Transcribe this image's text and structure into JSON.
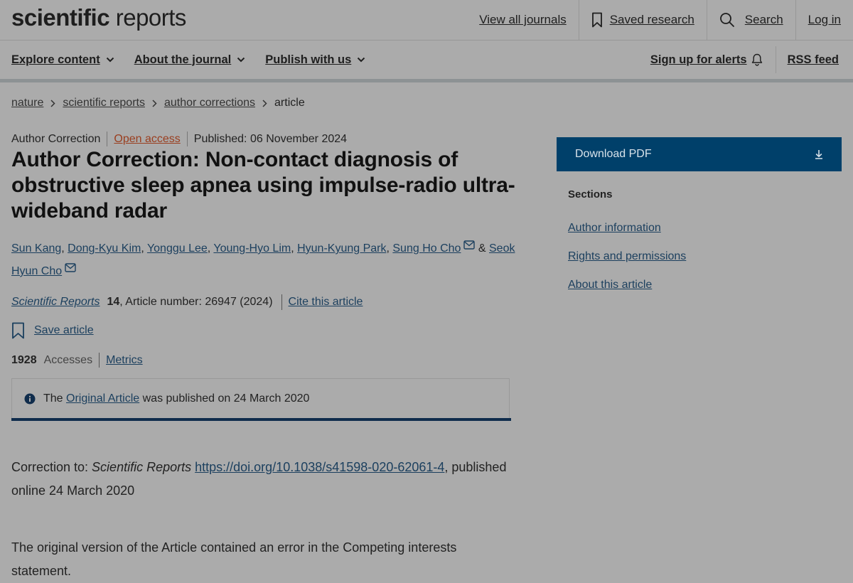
{
  "header": {
    "logo_bold": "scientific",
    "logo_light": " reports",
    "nav": {
      "view_all": "View all journals",
      "saved": "Saved research",
      "search": "Search",
      "login": "Log in"
    }
  },
  "subnav": {
    "explore": "Explore content",
    "about": "About the journal",
    "publish": "Publish with us",
    "alerts": "Sign up for alerts",
    "rss": "RSS feed"
  },
  "breadcrumb": {
    "items": [
      "nature",
      "scientific reports",
      "author corrections"
    ],
    "current": "article"
  },
  "article": {
    "type": "Author Correction",
    "access": "Open access",
    "published": "Published: 06 November 2024",
    "title": "Author Correction: Non-contact diagnosis of obstructive sleep apnea using impulse-radio ultra-wideband radar",
    "authors": [
      "Sun Kang",
      "Dong-Kyu Kim",
      "Yonggu Lee",
      "Young-Hyo Lim",
      "Hyun-Kyung Park",
      "Sung Ho Cho",
      "Seok Hyun Cho"
    ],
    "author_separator": ", ",
    "author_last_join": " & ",
    "journal": "Scientific Reports",
    "volume": "14",
    "article_number": ", Article number: 26947 (2024)",
    "cite": "Cite this article",
    "save": "Save article",
    "accesses_count": "1928",
    "accesses_label": "Accesses",
    "metrics": "Metrics"
  },
  "notice": {
    "prefix": "The ",
    "link": "Original Article",
    "suffix": " was published on 24 March 2020"
  },
  "body": {
    "p1_prefix": "Correction to: ",
    "p1_journal": "Scientific Reports",
    "p1_doi": "https://doi.org/10.1038/s41598-020-62061-4",
    "p1_suffix": ", published online 24 March 2020",
    "p2": "The original version of the Article contained an error in the Competing interests statement."
  },
  "sidebar": {
    "download": "Download PDF",
    "sections_title": "Sections",
    "sections": [
      "Author information",
      "Rights and permissions",
      "About this article"
    ]
  },
  "colors": {
    "background": "#ababab",
    "link": "#1b3f5e",
    "download_button": "#00406a",
    "open_access": "#9a3e1f"
  }
}
